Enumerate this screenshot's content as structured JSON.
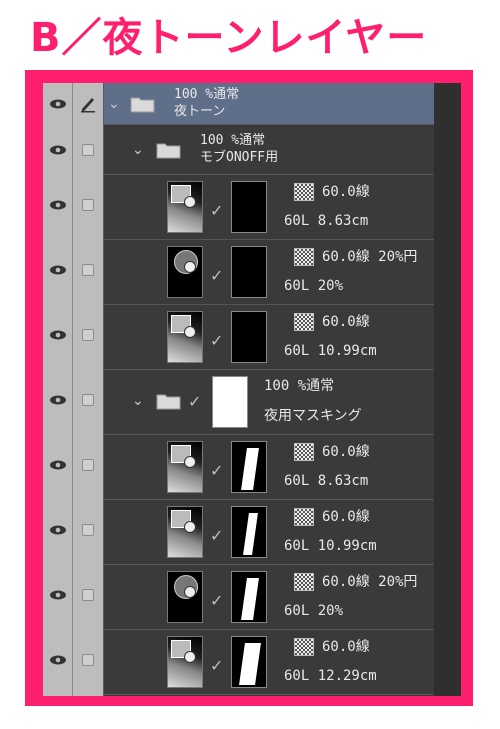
{
  "heading": "B／夜トーンレイヤー",
  "colors": {
    "accent": "#ff1f6e",
    "panel": "#3a3a3a",
    "selected": "#5f6f8a"
  },
  "icons": {
    "visibility": "eye-icon",
    "edit": "pen-icon",
    "folder": "folder-icon",
    "expand": "chevron-down-icon",
    "tone": "tone-icon",
    "check": "check-icon"
  },
  "layers": [
    {
      "opacity": "100 %通常",
      "name": "夜トーン"
    },
    {
      "opacity": "100 %通常",
      "name": "モブONOFF用"
    },
    {
      "tone_label": "60.0線",
      "name": "60L 8.63cm"
    },
    {
      "tone_label": "60.0線 20%円",
      "name": "60L 20%"
    },
    {
      "tone_label": "60.0線",
      "name": "60L 10.99cm"
    },
    {
      "opacity": "100 %通常",
      "name": "夜用マスキング"
    },
    {
      "tone_label": "60.0線",
      "name": "60L 8.63cm"
    },
    {
      "tone_label": "60.0線",
      "name": "60L 10.99cm"
    },
    {
      "tone_label": "60.0線 20%円",
      "name": "60L 20%"
    },
    {
      "tone_label": "60.0線",
      "name": "60L 12.29cm"
    }
  ]
}
